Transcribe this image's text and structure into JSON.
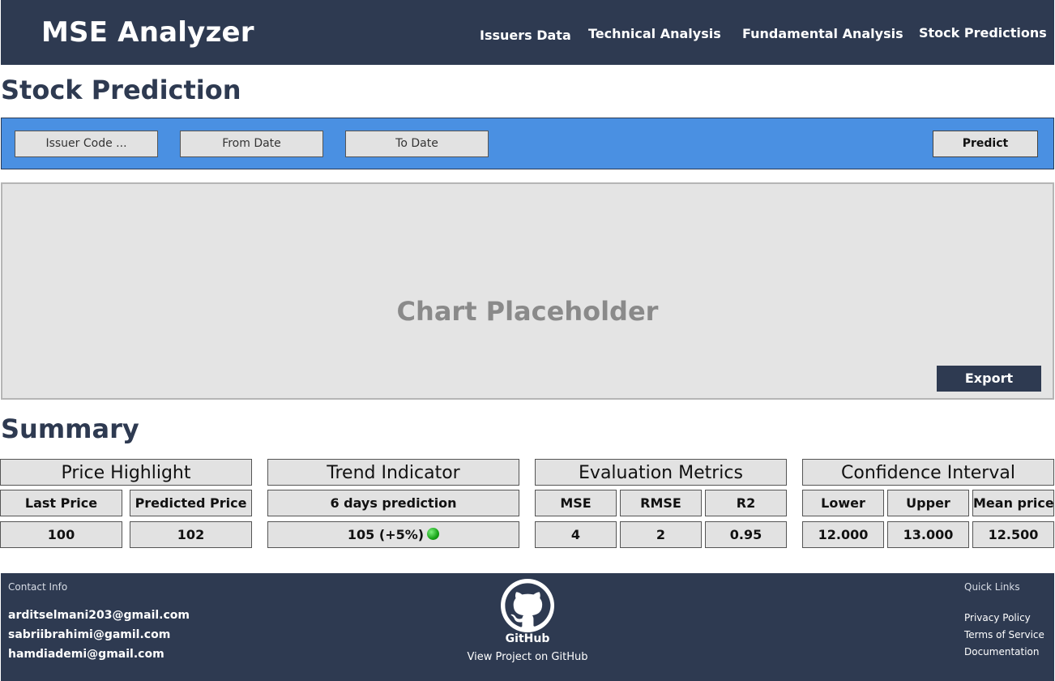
{
  "header": {
    "brand": "MSE Analyzer",
    "nav": [
      "Issuers Data",
      "Technical Analysis",
      "Fundamental Analysis",
      "Stock Predictions"
    ]
  },
  "page_title": "Stock Prediction",
  "toolbar": {
    "issuer_code": "Issuer Code ...",
    "from_date": "From Date",
    "to_date": "To Date",
    "predict_label": "Predict"
  },
  "chart": {
    "placeholder": "Chart Placeholder",
    "export_label": "Export"
  },
  "summary": {
    "title": "Summary",
    "price_highlight": {
      "title": "Price Highlight",
      "last_price_label": "Last Price",
      "predicted_price_label": "Predicted Price",
      "last_price": "100",
      "predicted_price": "102"
    },
    "trend_indicator": {
      "title": "Trend Indicator",
      "label": "6 days prediction",
      "value": "105 (+5%)",
      "status_color": "#17a317"
    },
    "evaluation_metrics": {
      "title": "Evaluation Metrics",
      "labels": [
        "MSE",
        "RMSE",
        "R2"
      ],
      "values": [
        "4",
        "2",
        "0.95"
      ]
    },
    "confidence_interval": {
      "title": "Confidence Interval",
      "labels": [
        "Lower",
        "Upper",
        "Mean price"
      ],
      "values": [
        "12.000",
        "13.000",
        "12.500"
      ]
    }
  },
  "footer": {
    "contact_label": "Contact Info",
    "emails": [
      "arditselmani203@gmail.com",
      "sabriibrahimi@gamil.com",
      "hamdiademi@gmail.com"
    ],
    "github_text": "GitHub",
    "github_link": "View Project on GitHub",
    "quick_links_label": "Quick Links",
    "links": [
      "Privacy Policy",
      "Terms of Service",
      "Documentation"
    ]
  },
  "colors": {
    "navy": "#2e3a51",
    "toolbar_blue": "#4a90e2",
    "panel_gray": "#e2e2e2"
  }
}
